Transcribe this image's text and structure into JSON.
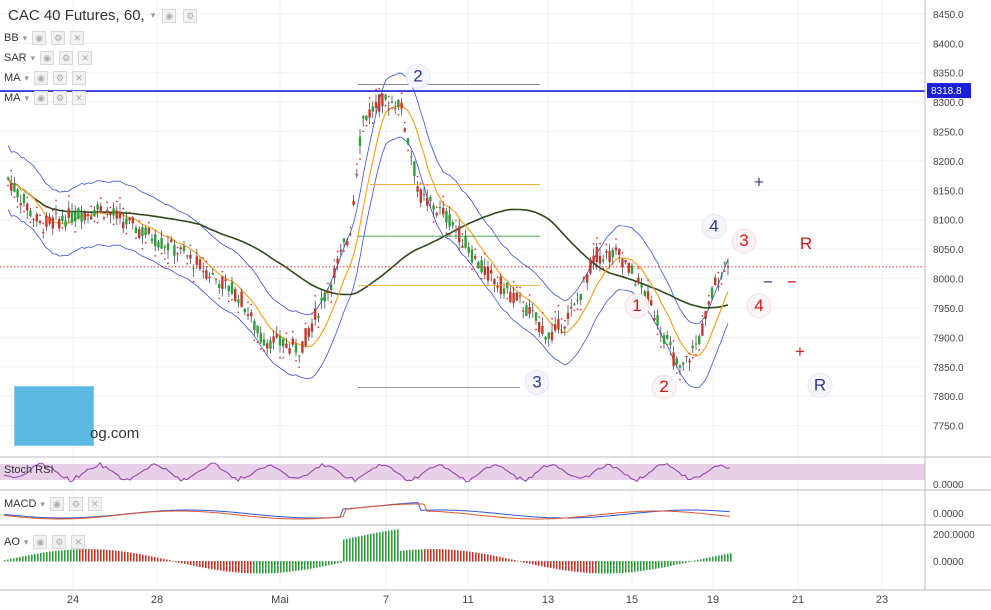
{
  "title": {
    "symbol": "CAC 40 Futures, 60,",
    "caret": "▾"
  },
  "indicators": [
    {
      "name": "BB"
    },
    {
      "name": "SAR"
    },
    {
      "name": "MA"
    },
    {
      "name": "MA"
    }
  ],
  "lower_panels": [
    {
      "name": "Stoch RSI"
    },
    {
      "name": "MACD"
    },
    {
      "name": "AO"
    }
  ],
  "logo": {
    "text": "og.com"
  },
  "icons": {
    "settings": "gear-icon",
    "visibility": "eye-icon",
    "close": "close-icon"
  },
  "colors": {
    "bg": "#ffffff",
    "up": "#2e9d3a",
    "down": "#c0392b",
    "bb": "#3a4fd7",
    "ma_long": "#2d4a1d",
    "ma_short": "#f2a52a",
    "sar": "#e23232",
    "stoch": "#8a3fa0",
    "price_line": "#1a1fd8"
  },
  "chart_data": {
    "type": "candlestick",
    "price_axis": {
      "ylim": [
        7700,
        8460
      ],
      "ticks": [
        "8450.0",
        "8400.0",
        "8350.0",
        "8300.0",
        "8250.0",
        "8200.0",
        "8150.0",
        "8100.0",
        "8050.0",
        "8000.0",
        "7950.0",
        "7900.0",
        "7850.0",
        "7800.0",
        "7750.0"
      ]
    },
    "x_ticks": [
      "24",
      "28",
      "Mai",
      "7",
      "11",
      "13",
      "15",
      "19",
      "21",
      "23"
    ],
    "current_price": "8318.8",
    "close_path": [
      [
        "24",
        8130
      ],
      [
        "28",
        8070
      ],
      [
        "Mai",
        7900
      ],
      [
        "7",
        8300
      ],
      [
        "11",
        8080
      ],
      [
        "13",
        7920
      ],
      [
        "15",
        8010
      ],
      [
        "19",
        7850
      ]
    ],
    "indicator_axes": {
      "stoch": [
        "0.0000"
      ],
      "macd": [
        "0.0000"
      ],
      "ao": [
        "200.0000",
        "0.0000"
      ]
    },
    "annotations": {
      "blue_labels": [
        "2",
        "3",
        "4",
        "R",
        "+",
        "−"
      ],
      "red_labels": [
        "1",
        "2",
        "3",
        "4",
        "R",
        "+",
        "−"
      ]
    }
  }
}
